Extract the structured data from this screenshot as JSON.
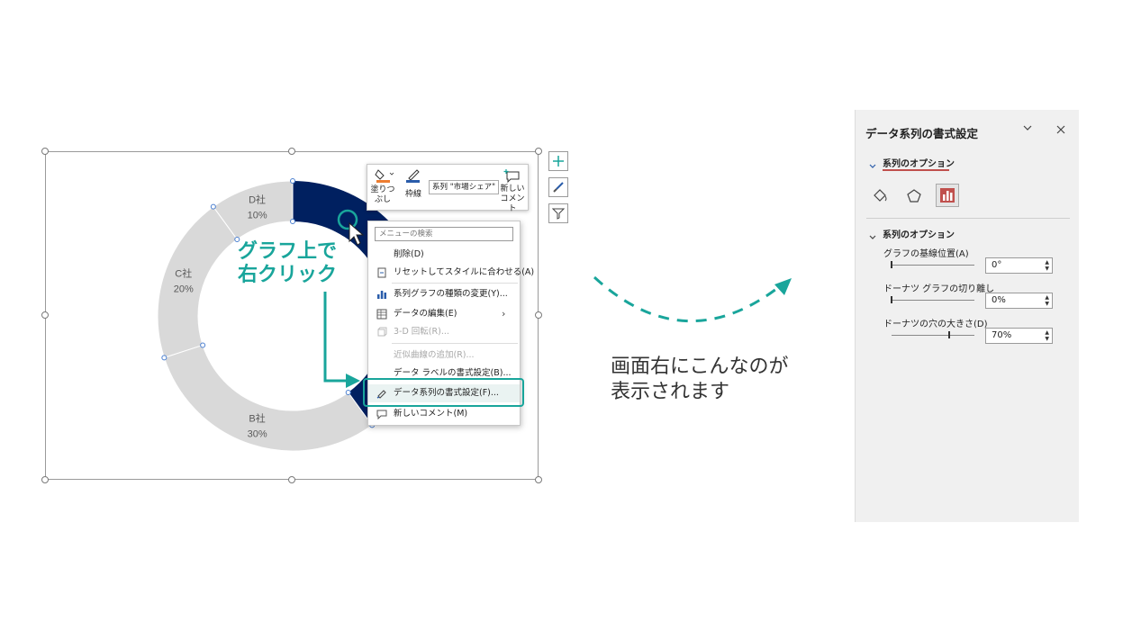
{
  "colors": {
    "accent_teal": "#19a59b",
    "navy": "#002060",
    "segment_gray": "#d9d9d9",
    "selected_icon_red": "#c0504d"
  },
  "chart_data": {
    "type": "pie",
    "title": "",
    "hole_percent": 70,
    "categories": [
      "D社",
      "C社",
      "B社"
    ],
    "values": [
      10,
      20,
      30
    ],
    "labels": [
      "10%",
      "20%",
      "30%"
    ]
  },
  "mini_toolbar": {
    "fill_label": "塗りつぶし",
    "outline_label": "枠線",
    "series_select": "系列 \"市場シェア\"",
    "new_comment_label": "新しいコメント"
  },
  "context_menu": {
    "search_placeholder": "メニューの検索",
    "items": [
      {
        "label": "削除(D)",
        "disabled": false
      },
      {
        "label": "リセットしてスタイルに合わせる(A)",
        "disabled": false
      },
      {
        "label": "系列グラフの種類の変更(Y)...",
        "disabled": false
      },
      {
        "label": "データの編集(E)",
        "disabled": false
      },
      {
        "label": "3-D 回転(R)...",
        "disabled": true
      },
      {
        "label": "近似曲線の追加(R)...",
        "disabled": true
      },
      {
        "label": "データ ラベルの書式設定(B)...",
        "disabled": false
      },
      {
        "label": "データ系列の書式設定(F)...",
        "disabled": false
      },
      {
        "label": "新しいコメント(M)",
        "disabled": false
      }
    ]
  },
  "annotation": {
    "line1": "グラフ上で",
    "line2": "右クリック"
  },
  "side_note": {
    "line1": "画面右にこんなのが",
    "line2": "表示されます"
  },
  "format_pane": {
    "title": "データ系列の書式設定",
    "tab_label": "系列のオプション",
    "section_label": "系列のオプション",
    "fields": [
      {
        "label": "グラフの基線位置(A)",
        "value": "0°",
        "level": 0
      },
      {
        "label": "ドーナツ グラフの切り離し",
        "value": "0%",
        "level": 0
      },
      {
        "label": "ドーナツの穴の大きさ(D)",
        "value": "70%",
        "level": 0.7
      }
    ]
  }
}
